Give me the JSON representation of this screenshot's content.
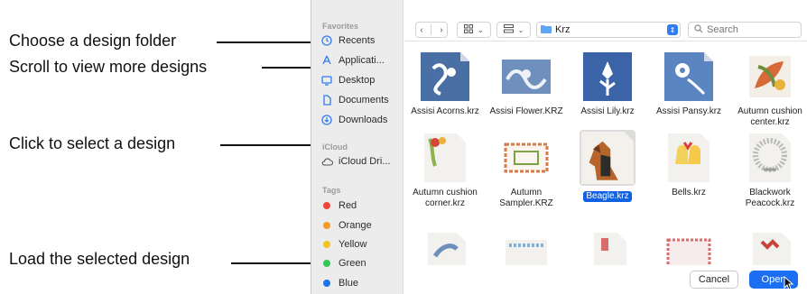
{
  "callouts": {
    "choose_folder": "Choose a design folder",
    "scroll": "Scroll to view more designs",
    "click_select": "Click to select a design",
    "load": "Load the selected design"
  },
  "sidebar": {
    "favorites_label": "Favorites",
    "favorites": [
      {
        "label": "Recents",
        "icon": "clock-icon"
      },
      {
        "label": "Applicati...",
        "icon": "applications-icon"
      },
      {
        "label": "Desktop",
        "icon": "desktop-icon"
      },
      {
        "label": "Documents",
        "icon": "document-icon"
      },
      {
        "label": "Downloads",
        "icon": "download-icon"
      }
    ],
    "icloud_label": "iCloud",
    "icloud": [
      {
        "label": "iCloud Dri...",
        "icon": "cloud-icon"
      }
    ],
    "tags_label": "Tags",
    "tags": [
      {
        "label": "Red",
        "color": "#f0443a"
      },
      {
        "label": "Orange",
        "color": "#f39a2b"
      },
      {
        "label": "Yellow",
        "color": "#f2c522"
      },
      {
        "label": "Green",
        "color": "#34c759"
      },
      {
        "label": "Blue",
        "color": "#1a73e8"
      }
    ]
  },
  "toolbar": {
    "back_icon": "chevron-left-icon",
    "forward_icon": "chevron-right-icon",
    "view_icon": "icon-view-icon",
    "group_icon": "group-icon",
    "folder_name": "Krz",
    "search_placeholder": "Search"
  },
  "files": [
    {
      "name": "Assisi Acorns.krz",
      "style": "blue"
    },
    {
      "name": "Assisi Flower.KRZ",
      "style": "blue"
    },
    {
      "name": "Assisi Lily.krz",
      "style": "blue"
    },
    {
      "name": "Assisi Pansy.krz",
      "style": "blue"
    },
    {
      "name": "Autumn cushion center.krz",
      "style": "autumn"
    },
    {
      "name": "Autumn cushion corner.krz",
      "style": "corner"
    },
    {
      "name": "Autumn Sampler.KRZ",
      "style": "sampler"
    },
    {
      "name": "Beagle.krz",
      "style": "beagle",
      "selected": true
    },
    {
      "name": "Bells.krz",
      "style": "bells"
    },
    {
      "name": "Blackwork Peacock.krz",
      "style": "lace"
    },
    {
      "name": "",
      "style": "partial"
    },
    {
      "name": "",
      "style": "partial"
    },
    {
      "name": "",
      "style": "partial"
    },
    {
      "name": "",
      "style": "partial"
    },
    {
      "name": "",
      "style": "partial"
    }
  ],
  "footer": {
    "cancel_label": "Cancel",
    "open_label": "Open"
  }
}
